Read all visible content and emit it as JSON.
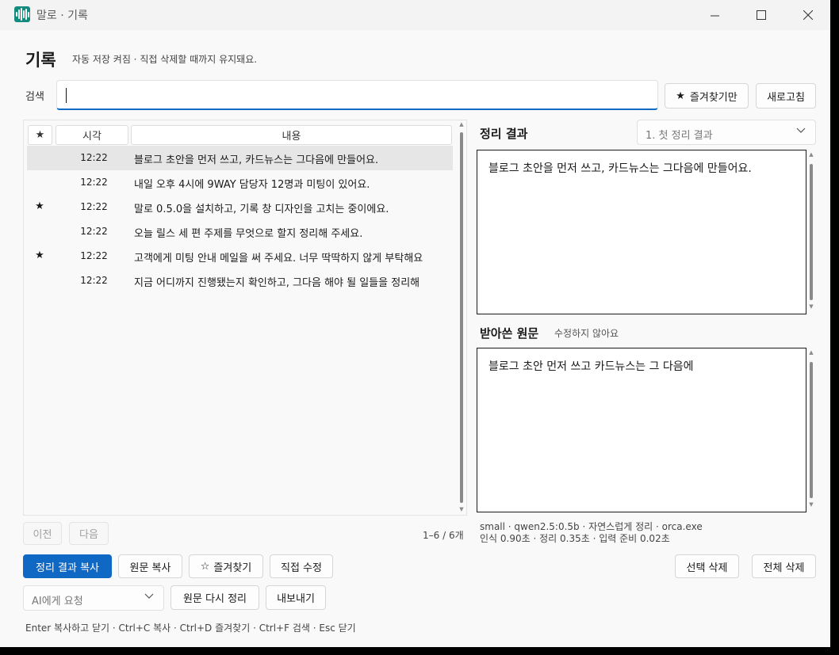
{
  "window": {
    "title": "말로 · 기록"
  },
  "header": {
    "title": "기록",
    "subtitle": "자동 저장 켜짐 · 직접 삭제할 때까지 유지돼요."
  },
  "search": {
    "label": "검색",
    "value": "",
    "placeholder": "",
    "favorites_only_label": "즐겨찾기만",
    "refresh_label": "새로고침"
  },
  "list": {
    "columns": {
      "star": "★",
      "time": "시각",
      "content": "내용"
    },
    "rows": [
      {
        "star": "",
        "time": "12:22",
        "text": "블로그 초안을 먼저 쓰고, 카드뉴스는 그다음에 만들어요.",
        "selected": true
      },
      {
        "star": "",
        "time": "12:22",
        "text": "내일 오후 4시에 9WAY 담당자 12명과 미팅이 있어요.",
        "selected": false
      },
      {
        "star": "★",
        "time": "12:22",
        "text": "말로 0.5.0을 설치하고, 기록 창 디자인을 고치는 중이에요.",
        "selected": false
      },
      {
        "star": "",
        "time": "12:22",
        "text": "오늘 릴스 세 편 주제를 무엇으로 할지 정리해 주세요.",
        "selected": false
      },
      {
        "star": "★",
        "time": "12:22",
        "text": "고객에게 미팅 안내 메일을 써 주세요. 너무 딱딱하지 않게 부탁해요",
        "selected": false
      },
      {
        "star": "",
        "time": "12:22",
        "text": "지금 어디까지 진행됐는지 확인하고, 그다음 해야 될 일들을 정리해",
        "selected": false
      }
    ],
    "prev_label": "이전",
    "next_label": "다음",
    "range_text": "1–6 / 6개"
  },
  "result": {
    "title": "정리 결과",
    "selector_value": "1. 첫 정리 결과",
    "text": "블로그 초안을 먼저 쓰고, 카드뉴스는 그다음에 만들어요."
  },
  "original": {
    "title": "받아쓴 원문",
    "subtitle": "수정하지 않아요",
    "text": "블로그 초안 먼저 쓰고 카드뉴스는 그 다음에"
  },
  "meta": {
    "line1": "small · qwen2.5:0.5b · 자연스럽게 정리 · orca.exe",
    "line2": "인식 0.90초 · 정리 0.35초 · 입력 준비 0.02초"
  },
  "actions": {
    "copy_result": "정리 결과 복사",
    "copy_original": "원문 복사",
    "favorite": "즐겨찾기",
    "edit": "직접 수정",
    "delete_selected": "선택 삭제",
    "delete_all": "전체 삭제",
    "ai_request": "AI에게 요청",
    "reprocess": "원문 다시 정리",
    "export": "내보내기"
  },
  "hints": "Enter 복사하고 닫기  ·  Ctrl+C 복사  ·  Ctrl+D 즐겨찾기  ·  Ctrl+F 검색  ·  Esc 닫기",
  "colors": {
    "accent": "#0e68c4",
    "app_icon": "#138a7e"
  }
}
